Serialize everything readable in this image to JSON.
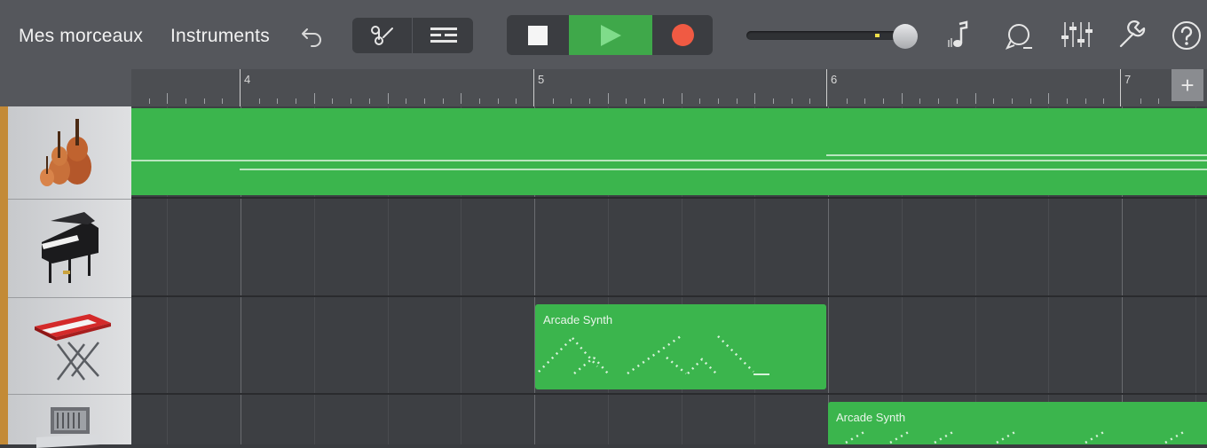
{
  "toolbar": {
    "my_songs": "Mes morceaux",
    "instruments": "Instruments",
    "icons": [
      "undo-icon",
      "track-view-icon",
      "tracks-list-icon",
      "stop-icon",
      "play-icon",
      "record-icon",
      "volume-slider",
      "metronome-icon",
      "loop-browser-icon",
      "mixer-icon",
      "settings-wrench-icon",
      "help-icon"
    ]
  },
  "transport": {
    "play_active": true,
    "colors": {
      "play": "#3fa84a",
      "record": "#f05a43",
      "stop": "#f5f5f5"
    }
  },
  "ruler": {
    "bars": [
      "4",
      "5",
      "6",
      "7"
    ],
    "add_label": "+"
  },
  "tracks": [
    {
      "instrument": "strings",
      "icon": "cello-icon"
    },
    {
      "instrument": "piano",
      "icon": "grand-piano-icon"
    },
    {
      "instrument": "keyboard",
      "icon": "synth-keyboard-icon"
    },
    {
      "instrument": "synth",
      "icon": "analog-synth-icon"
    }
  ],
  "regions": [
    {
      "track": 0,
      "label": ""
    },
    {
      "track": 2,
      "label": "Arcade Synth"
    },
    {
      "track": 3,
      "label": "Arcade Synth"
    }
  ],
  "colors": {
    "region": "#3bb54d",
    "toolbar": "#55575c",
    "lane": "#3d3f43"
  }
}
